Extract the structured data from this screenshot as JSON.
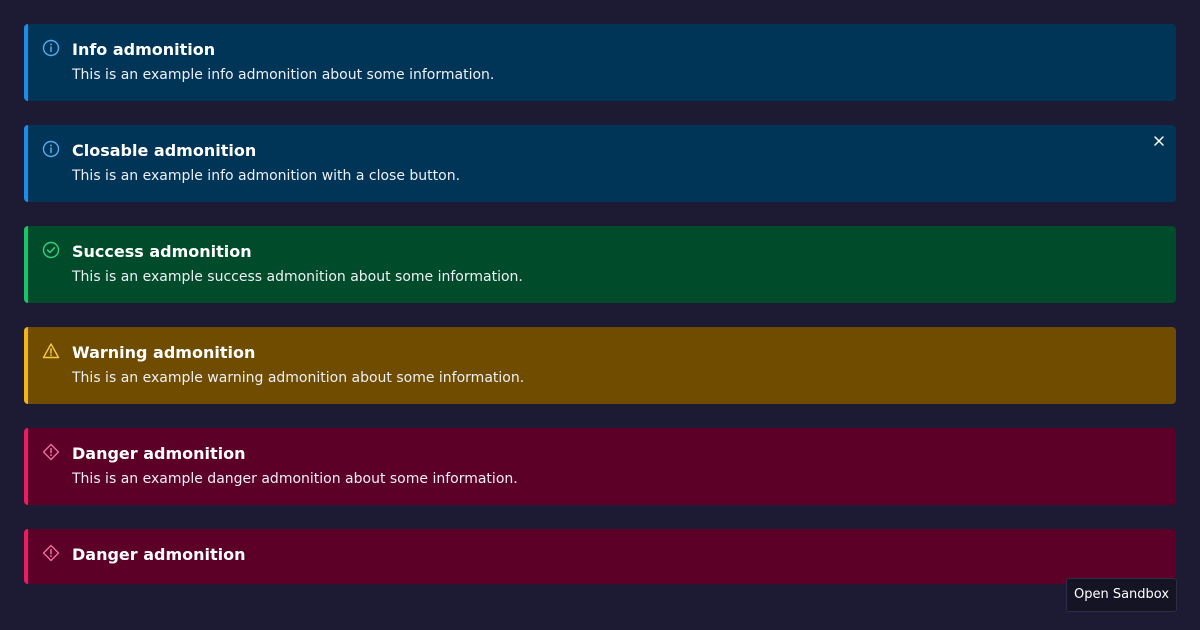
{
  "colors": {
    "background": "#1d1a33",
    "info_bg": "#003557",
    "info_accent": "#1c8eea",
    "success_bg": "#004b2a",
    "success_accent": "#17c767",
    "warning_bg": "#6f4c00",
    "warning_accent": "#f2b419",
    "danger_bg": "#5d0027",
    "danger_accent": "#ee1a64"
  },
  "admonitions": [
    {
      "variant": "info",
      "icon": "info-circle-icon",
      "title": "Info admonition",
      "description": "This is an example info admonition about some information.",
      "closable": false
    },
    {
      "variant": "info",
      "icon": "info-circle-icon",
      "title": "Closable admonition",
      "description": "This is an example info admonition with a close button.",
      "closable": true
    },
    {
      "variant": "success",
      "icon": "check-circle-icon",
      "title": "Success admonition",
      "description": "This is an example success admonition about some information.",
      "closable": false
    },
    {
      "variant": "warning",
      "icon": "warning-triangle-icon",
      "title": "Warning admonition",
      "description": "This is an example warning admonition about some information.",
      "closable": false
    },
    {
      "variant": "danger",
      "icon": "danger-diamond-icon",
      "title": "Danger admonition",
      "description": "This is an example danger admonition about some information.",
      "closable": false
    },
    {
      "variant": "danger",
      "icon": "danger-diamond-icon",
      "title": "Danger admonition",
      "closable": false
    }
  ],
  "sandbox_button": {
    "label": "Open Sandbox"
  }
}
